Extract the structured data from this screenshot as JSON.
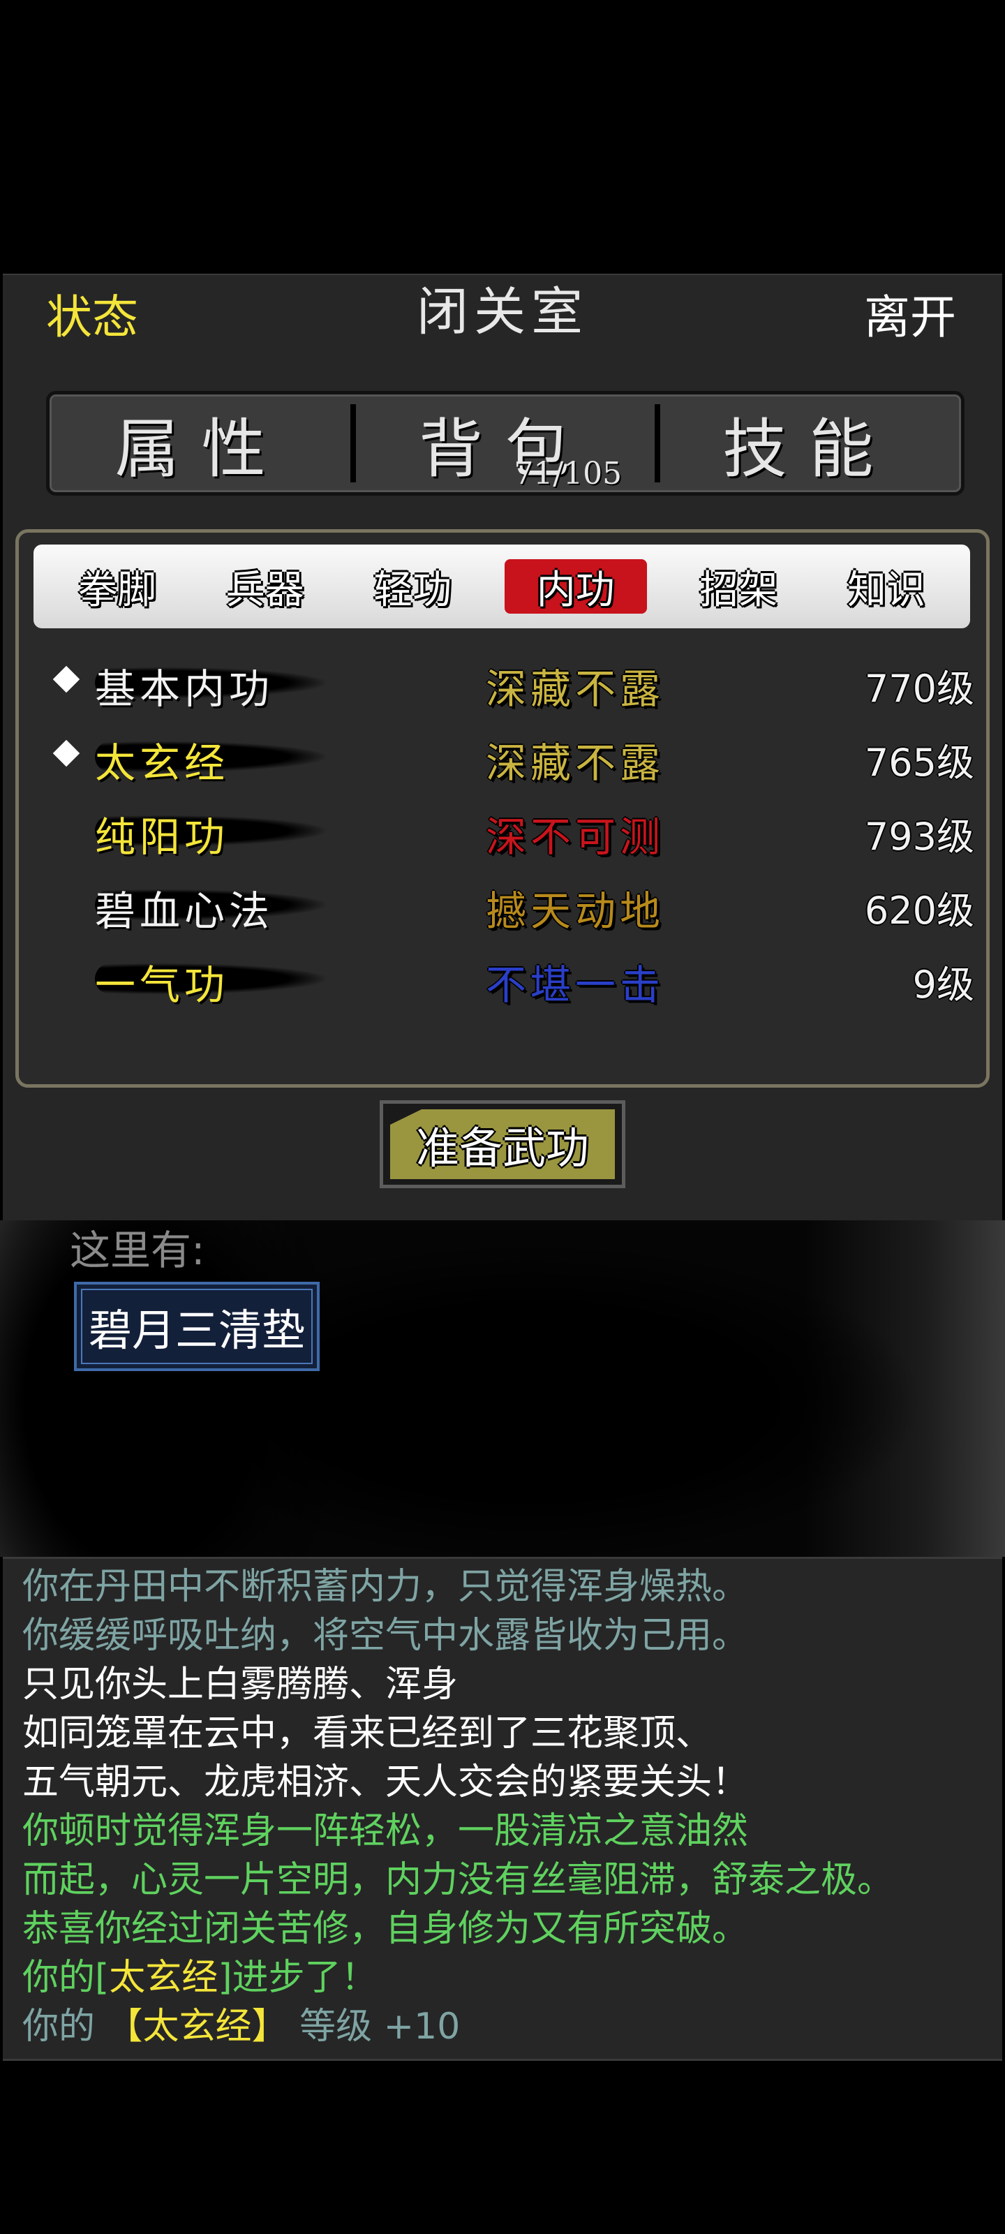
{
  "header": {
    "status_label": "状态",
    "room_title": "闭关室",
    "leave_label": "离开"
  },
  "main_tabs": [
    {
      "label": "属性"
    },
    {
      "label": "背包",
      "count": "71/105"
    },
    {
      "label": "技能"
    }
  ],
  "sub_tabs": [
    {
      "label": "拳脚",
      "active": false
    },
    {
      "label": "兵器",
      "active": false
    },
    {
      "label": "轻功",
      "active": false
    },
    {
      "label": "内功",
      "active": true
    },
    {
      "label": "招架",
      "active": false
    },
    {
      "label": "知识",
      "active": false
    }
  ],
  "skills": [
    {
      "name": "基本内功",
      "rank": "深藏不露",
      "level": "770级",
      "equipped": true,
      "name_color": "#f2f2f2",
      "rank_color": "#c9b441"
    },
    {
      "name": "太玄经",
      "rank": "深藏不露",
      "level": "765级",
      "equipped": true,
      "name_color": "#f4e53a",
      "rank_color": "#c9b441"
    },
    {
      "name": "纯阳功",
      "rank": "深不可测",
      "level": "793级",
      "equipped": false,
      "name_color": "#f4e53a",
      "rank_color": "#c8141c"
    },
    {
      "name": "碧血心法",
      "rank": "撼天动地",
      "level": "620级",
      "equipped": false,
      "name_color": "#f2f2f2",
      "rank_color": "#b88a1c"
    },
    {
      "name": "一气功",
      "rank": "不堪一击",
      "level": "9级",
      "equipped": false,
      "name_color": "#f4e53a",
      "rank_color": "#2a3fc8"
    }
  ],
  "prepare_button": "准备武功",
  "scene": {
    "here_label": "这里有:",
    "item": "碧月三清垫"
  },
  "log": [
    {
      "text": "你在丹田中不断积蓄内力，只觉得浑身燥热。",
      "color": "#7fa4a4"
    },
    {
      "text": "你缓缓呼吸吐纳，将空气中水露皆收为己用。",
      "color": "#7fa4a4"
    },
    {
      "text": "只见你头上白雾腾腾、浑身",
      "color": "#ffffff"
    },
    {
      "text": "如同笼罩在云中，看来已经到了三花聚顶、",
      "color": "#ffffff"
    },
    {
      "text": "五气朝元、龙虎相济、天人交会的紧要关头！",
      "color": "#ffffff"
    },
    {
      "text": "你顿时觉得浑身一阵轻松，一股清凉之意油然",
      "color": "#5fd25f"
    },
    {
      "text": "而起，心灵一片空明，内力没有丝毫阻滞，舒泰之极。",
      "color": "#5fd25f"
    },
    {
      "text": "恭喜你经过闭关苦修，自身修为又有所突破。",
      "color": "#5fd25f"
    },
    {
      "segments": [
        {
          "text": "你的[",
          "color": "#5fd25f"
        },
        {
          "text": "太玄经",
          "color": "#f4e53a"
        },
        {
          "text": "]进步了！",
          "color": "#5fd25f"
        }
      ]
    },
    {
      "segments": [
        {
          "text": "你的 ",
          "color": "#7fa4a4"
        },
        {
          "text": "【太玄经】",
          "color": "#f4e53a"
        },
        {
          "text": " 等级 +10",
          "color": "#7fa4a4"
        }
      ]
    }
  ]
}
